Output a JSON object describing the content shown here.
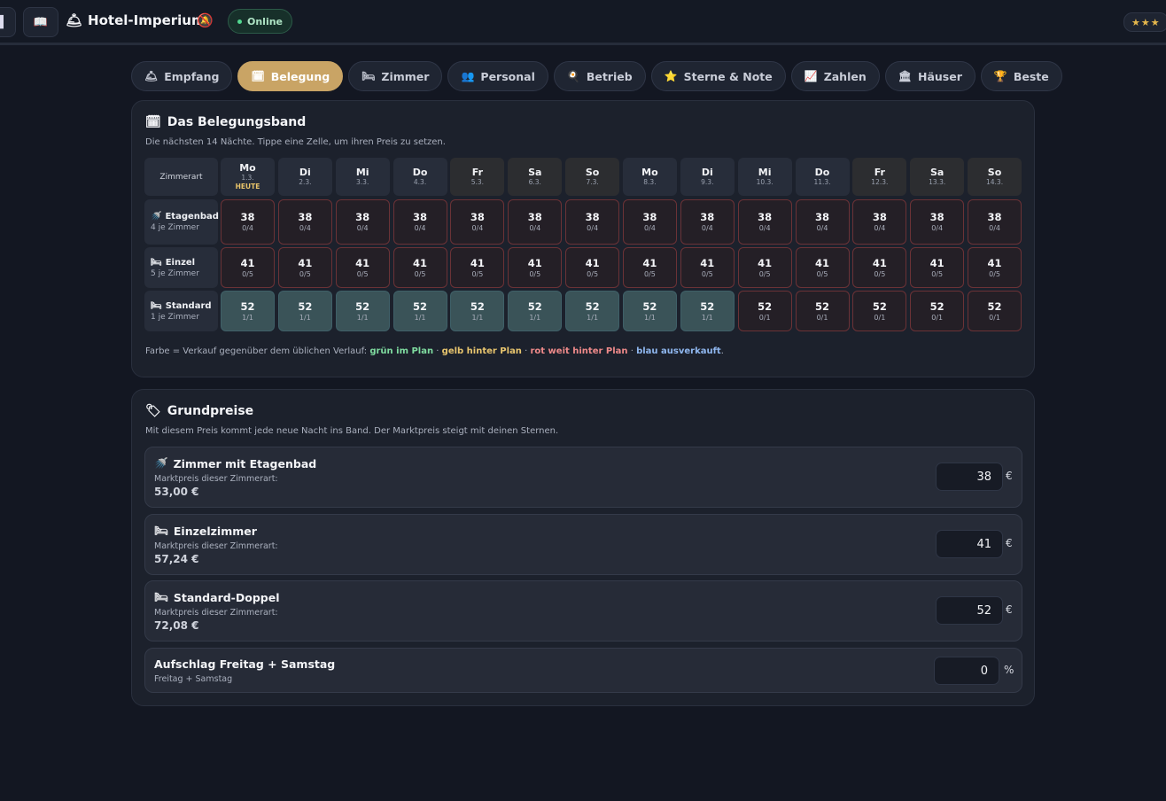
{
  "topbar": {
    "brand_icon": "bellhop-icon",
    "brand": "Hotel-Imperium",
    "status": "Online",
    "stars": "★★★"
  },
  "tabs": [
    {
      "icon": "🛎",
      "label": "Empfang",
      "active": false
    },
    {
      "icon": "🗓",
      "label": "Belegung",
      "active": true
    },
    {
      "icon": "🛏",
      "label": "Zimmer",
      "active": false
    },
    {
      "icon": "👥",
      "label": "Personal",
      "active": false
    },
    {
      "icon": "🍳",
      "label": "Betrieb",
      "active": false
    },
    {
      "icon": "⭐",
      "label": "Sterne & Note",
      "active": false
    },
    {
      "icon": "📈",
      "label": "Zahlen",
      "active": false
    },
    {
      "icon": "🏛",
      "label": "Häuser",
      "active": false
    },
    {
      "icon": "🏆",
      "label": "Beste",
      "active": false
    }
  ],
  "band": {
    "icon": "🗓",
    "title": "Das Belegungsband",
    "subtitle": "Die nächsten 14 Nächte. Tippe eine Zelle, um ihren Preis zu setzen.",
    "corner": "Zimmerart",
    "days": [
      {
        "dn": "Mo",
        "dd": "1.3.",
        "today": "HEUTE",
        "weekend": false
      },
      {
        "dn": "Di",
        "dd": "2.3.",
        "weekend": false
      },
      {
        "dn": "Mi",
        "dd": "3.3.",
        "weekend": false
      },
      {
        "dn": "Do",
        "dd": "4.3.",
        "weekend": false
      },
      {
        "dn": "Fr",
        "dd": "5.3.",
        "weekend": true
      },
      {
        "dn": "Sa",
        "dd": "6.3.",
        "weekend": true
      },
      {
        "dn": "So",
        "dd": "7.3.",
        "weekend": true
      },
      {
        "dn": "Mo",
        "dd": "8.3.",
        "weekend": false
      },
      {
        "dn": "Di",
        "dd": "9.3.",
        "weekend": false
      },
      {
        "dn": "Mi",
        "dd": "10.3.",
        "weekend": false
      },
      {
        "dn": "Do",
        "dd": "11.3.",
        "weekend": false
      },
      {
        "dn": "Fr",
        "dd": "12.3.",
        "weekend": true
      },
      {
        "dn": "Sa",
        "dd": "13.3.",
        "weekend": true
      },
      {
        "dn": "So",
        "dd": "14.3.",
        "weekend": true
      }
    ],
    "rows": [
      {
        "icon": "🚿",
        "name": "Etagenbad",
        "count": "4 je Zimmer",
        "cells": [
          [
            "38",
            "0/4"
          ],
          [
            "38",
            "0/4"
          ],
          [
            "38",
            "0/4"
          ],
          [
            "38",
            "0/4"
          ],
          [
            "38",
            "0/4"
          ],
          [
            "38",
            "0/4"
          ],
          [
            "38",
            "0/4"
          ],
          [
            "38",
            "0/4"
          ],
          [
            "38",
            "0/4"
          ],
          [
            "38",
            "0/4"
          ],
          [
            "38",
            "0/4"
          ],
          [
            "38",
            "0/4"
          ],
          [
            "38",
            "0/4"
          ],
          [
            "38",
            "0/4"
          ]
        ],
        "status": [
          "red",
          "red",
          "red",
          "red",
          "red",
          "red",
          "red",
          "red",
          "red",
          "red",
          "red",
          "red",
          "red",
          "red"
        ]
      },
      {
        "icon": "🛏",
        "name": "Einzel",
        "count": "5 je Zimmer",
        "cells": [
          [
            "41",
            "0/5"
          ],
          [
            "41",
            "0/5"
          ],
          [
            "41",
            "0/5"
          ],
          [
            "41",
            "0/5"
          ],
          [
            "41",
            "0/5"
          ],
          [
            "41",
            "0/5"
          ],
          [
            "41",
            "0/5"
          ],
          [
            "41",
            "0/5"
          ],
          [
            "41",
            "0/5"
          ],
          [
            "41",
            "0/5"
          ],
          [
            "41",
            "0/5"
          ],
          [
            "41",
            "0/5"
          ],
          [
            "41",
            "0/5"
          ],
          [
            "41",
            "0/5"
          ]
        ],
        "status": [
          "red",
          "red",
          "red",
          "red",
          "red",
          "red",
          "red",
          "red",
          "red",
          "red",
          "red",
          "red",
          "red",
          "red"
        ]
      },
      {
        "icon": "🛏",
        "name": "Standard",
        "count": "1 je Zimmer",
        "cells": [
          [
            "52",
            "1/1"
          ],
          [
            "52",
            "1/1"
          ],
          [
            "52",
            "1/1"
          ],
          [
            "52",
            "1/1"
          ],
          [
            "52",
            "1/1"
          ],
          [
            "52",
            "1/1"
          ],
          [
            "52",
            "1/1"
          ],
          [
            "52",
            "1/1"
          ],
          [
            "52",
            "1/1"
          ],
          [
            "52",
            "0/1"
          ],
          [
            "52",
            "0/1"
          ],
          [
            "52",
            "0/1"
          ],
          [
            "52",
            "0/1"
          ],
          [
            "52",
            "0/1"
          ]
        ],
        "status": [
          "blue",
          "blue",
          "blue",
          "blue",
          "blue",
          "blue",
          "blue",
          "blue",
          "blue",
          "red",
          "red",
          "red",
          "red",
          "red"
        ]
      }
    ],
    "legend": {
      "prefix": "Farbe = Verkauf gegenüber dem üblichen Verlauf: ",
      "green": "grün im Plan",
      "sep": " · ",
      "yellow": "gelb hinter Plan",
      "red": "rot weit hinter Plan",
      "blue": "blau ausverkauft",
      "end": "."
    },
    "colors": {
      "red_border": "#6b3236",
      "blue_fill": "#3a5358"
    }
  },
  "prices": {
    "icon": "🏷",
    "title": "Grundpreise",
    "subtitle": "Mit diesem Preis kommt jede neue Nacht ins Band. Der Marktpreis steigt mit deinen Sternen.",
    "rows": [
      {
        "icon": "🚿",
        "title": "Zimmer mit Etagenbad",
        "sub": "Marktpreis dieser Zimmerart:",
        "market": "53,00 €",
        "value": "38",
        "unit": "€"
      },
      {
        "icon": "🛏",
        "title": "Einzelzimmer",
        "sub": "Marktpreis dieser Zimmerart:",
        "market": "57,24 €",
        "value": "41",
        "unit": "€"
      },
      {
        "icon": "🛏",
        "title": "Standard-Doppel",
        "sub": "Marktpreis dieser Zimmerart:",
        "market": "72,08 €",
        "value": "52",
        "unit": "€"
      },
      {
        "icon": "",
        "title": "Aufschlag Freitag + Samstag",
        "sub": "Freitag + Samstag",
        "market": "",
        "value": "0",
        "unit": "%"
      }
    ]
  }
}
